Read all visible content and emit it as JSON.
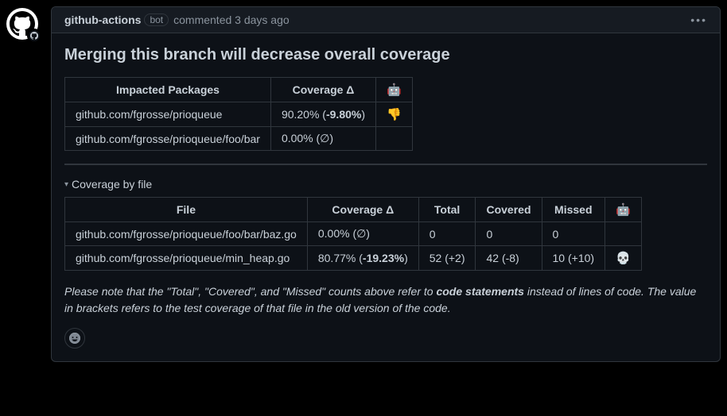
{
  "header": {
    "author": "github-actions",
    "bot_label": "bot",
    "commented_prefix": " commented ",
    "timestamp": "3 days ago"
  },
  "title": "Merging this branch will decrease overall coverage",
  "packages_table": {
    "headers": [
      "Impacted Packages",
      "Coverage Δ",
      "🤖"
    ],
    "rows": [
      {
        "pkg": "github.com/fgrosse/prioqueue",
        "cov_pre": "90.20% (",
        "cov_bold": "-9.80%",
        "cov_post": ")",
        "emoji": "👎"
      },
      {
        "pkg": "github.com/fgrosse/prioqueue/foo/bar",
        "cov_pre": "0.00% (∅)",
        "cov_bold": "",
        "cov_post": "",
        "emoji": ""
      }
    ]
  },
  "details_label": "Coverage by file",
  "files_table": {
    "headers": [
      "File",
      "Coverage Δ",
      "Total",
      "Covered",
      "Missed",
      "🤖"
    ],
    "rows": [
      {
        "file": "github.com/fgrosse/prioqueue/foo/bar/baz.go",
        "cov_pre": "0.00% (∅)",
        "cov_bold": "",
        "cov_post": "",
        "total": "0",
        "covered": "0",
        "missed": "0",
        "emoji": ""
      },
      {
        "file": "github.com/fgrosse/prioqueue/min_heap.go",
        "cov_pre": "80.77% (",
        "cov_bold": "-19.23%",
        "cov_post": ")",
        "total": "52 (+2)",
        "covered": "42 (-8)",
        "missed": "10 (+10)",
        "emoji": "💀"
      }
    ]
  },
  "note": {
    "pre": "Please note that the \"Total\", \"Covered\", and \"Missed\" counts above refer to ",
    "strong": "code statements",
    "post": " instead of lines of code. The value in brackets refers to the test coverage of that file in the old version of the code."
  },
  "chart_data": [
    {
      "type": "table",
      "title": "Impacted Packages",
      "columns": [
        "Impacted Packages",
        "Coverage Δ",
        "🤖"
      ],
      "rows": [
        [
          "github.com/fgrosse/prioqueue",
          "90.20% (-9.80%)",
          "👎"
        ],
        [
          "github.com/fgrosse/prioqueue/foo/bar",
          "0.00% (∅)",
          ""
        ]
      ]
    },
    {
      "type": "table",
      "title": "Coverage by file",
      "columns": [
        "File",
        "Coverage Δ",
        "Total",
        "Covered",
        "Missed",
        "🤖"
      ],
      "rows": [
        [
          "github.com/fgrosse/prioqueue/foo/bar/baz.go",
          "0.00% (∅)",
          0,
          0,
          0,
          ""
        ],
        [
          "github.com/fgrosse/prioqueue/min_heap.go",
          "80.77% (-19.23%)",
          "52 (+2)",
          "42 (-8)",
          "10 (+10)",
          "💀"
        ]
      ]
    }
  ]
}
